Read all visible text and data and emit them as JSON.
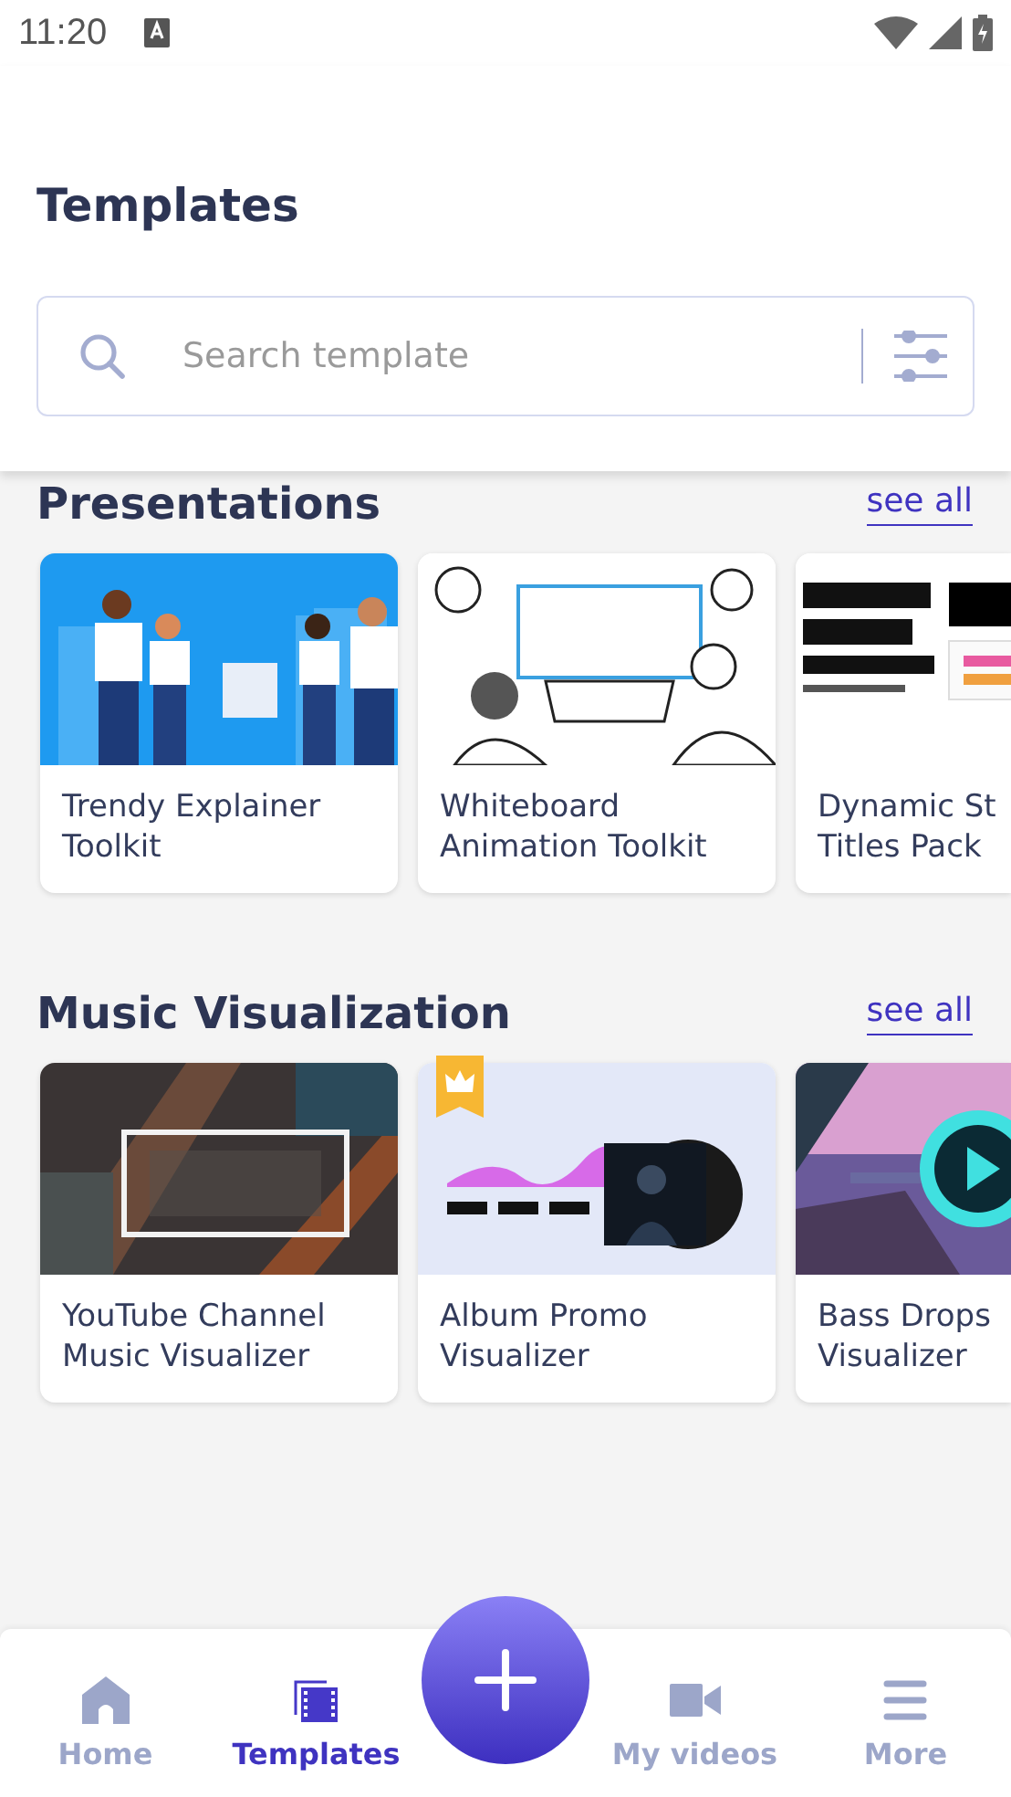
{
  "status_bar": {
    "time": "11:20"
  },
  "header": {
    "title": "Templates",
    "search": {
      "placeholder": "Search template"
    }
  },
  "sections": [
    {
      "title": "Presentations",
      "link": "see all",
      "cards": [
        {
          "title": "Trendy Explainer\nToolkit",
          "premium": false
        },
        {
          "title": "Whiteboard\nAnimation Toolkit",
          "premium": false
        },
        {
          "title": "Dynamic St\nTitles Pack",
          "premium": false
        }
      ]
    },
    {
      "title": "Music Visualization",
      "link": "see all",
      "cards": [
        {
          "title": "YouTube Channel\nMusic Visualizer",
          "premium": false
        },
        {
          "title": "Album Promo\nVisualizer",
          "premium": true
        },
        {
          "title": "Bass Drops\nVisualizer",
          "premium": false
        }
      ]
    }
  ],
  "nav": {
    "items": [
      {
        "kind": "home",
        "label": "Home",
        "selected": false
      },
      {
        "kind": "templates",
        "label": "Templates",
        "selected": true
      },
      {
        "kind": "create"
      },
      {
        "kind": "videos",
        "label": "My videos",
        "selected": false
      },
      {
        "kind": "more",
        "label": "More",
        "selected": false
      }
    ]
  }
}
